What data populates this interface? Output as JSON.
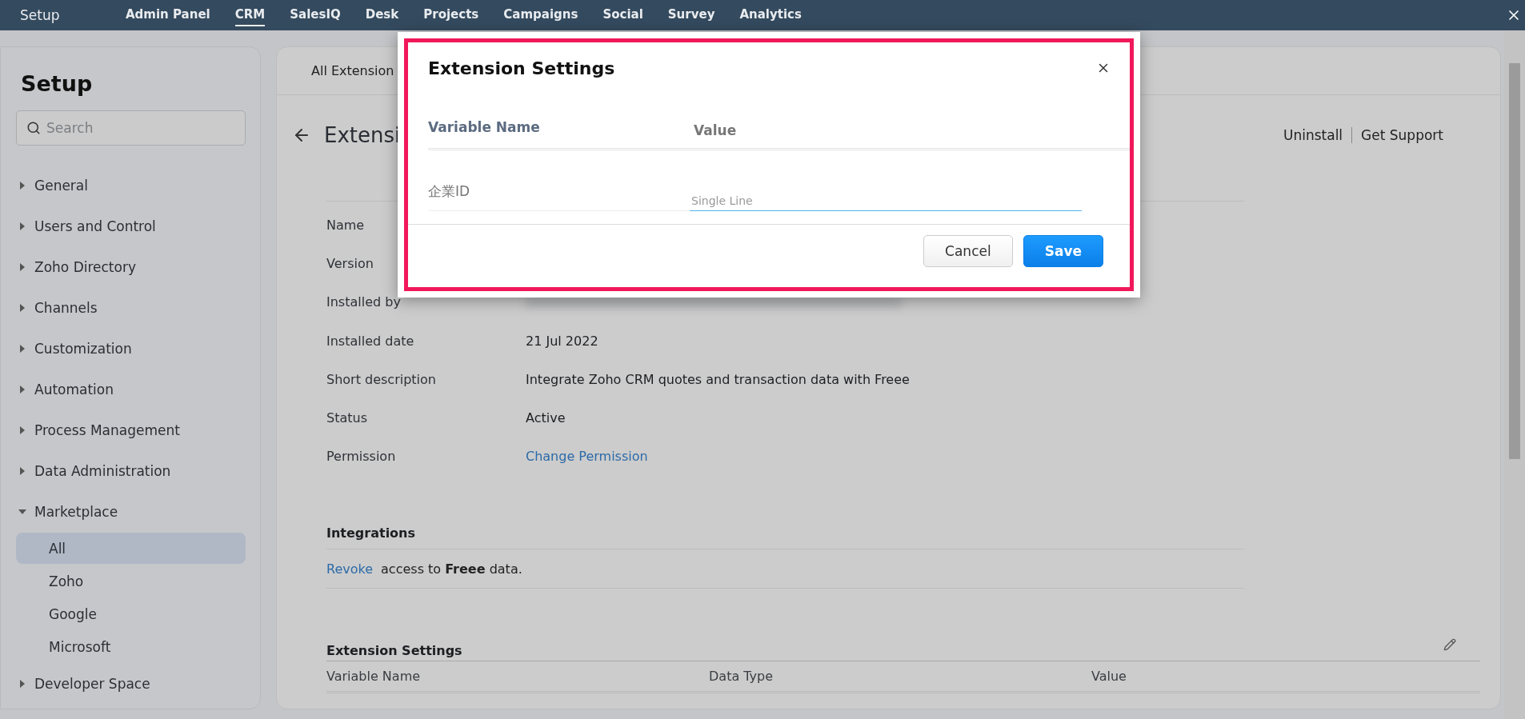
{
  "topbar": {
    "title": "Setup",
    "tabs": [
      {
        "label": "Admin Panel",
        "selected": false
      },
      {
        "label": "CRM",
        "selected": true
      },
      {
        "label": "SalesIQ",
        "selected": false
      },
      {
        "label": "Desk",
        "selected": false
      },
      {
        "label": "Projects",
        "selected": false
      },
      {
        "label": "Campaigns",
        "selected": false
      },
      {
        "label": "Social",
        "selected": false
      },
      {
        "label": "Survey",
        "selected": false
      },
      {
        "label": "Analytics",
        "selected": false
      }
    ]
  },
  "sidebar": {
    "title": "Setup",
    "search": {
      "placeholder": "Search"
    },
    "items": [
      {
        "label": "General",
        "expanded": false
      },
      {
        "label": "Users and Control",
        "expanded": false
      },
      {
        "label": "Zoho Directory",
        "expanded": false
      },
      {
        "label": "Channels",
        "expanded": false
      },
      {
        "label": "Customization",
        "expanded": false
      },
      {
        "label": "Automation",
        "expanded": false
      },
      {
        "label": "Process Management",
        "expanded": false
      },
      {
        "label": "Data Administration",
        "expanded": false
      },
      {
        "label": "Marketplace",
        "expanded": true,
        "children": [
          {
            "label": "All",
            "selected": true
          },
          {
            "label": "Zoho",
            "selected": false
          },
          {
            "label": "Google",
            "selected": false
          },
          {
            "label": "Microsoft",
            "selected": false
          }
        ]
      },
      {
        "label": "Developer Space",
        "expanded": false
      }
    ]
  },
  "main": {
    "tab": "All Extension",
    "heading": "Extensi",
    "actions": [
      "Uninstall",
      "Get Support"
    ],
    "details": [
      {
        "label": "Name",
        "kind": "hidden"
      },
      {
        "label": "Version",
        "kind": "hidden"
      },
      {
        "label": "Installed by",
        "kind": "blurred"
      },
      {
        "label": "Installed date",
        "kind": "text",
        "value": "21 Jul 2022"
      },
      {
        "label": "Short description",
        "kind": "text",
        "value": "Integrate Zoho CRM quotes and transaction data with Freee"
      },
      {
        "label": "Status",
        "kind": "text",
        "value": "Active"
      },
      {
        "label": "Permission",
        "kind": "link",
        "value": "Change Permission"
      }
    ],
    "integrations": {
      "title": "Integrations",
      "link": "Revoke",
      "text": "access to **Freee** data."
    },
    "extension_settings": {
      "title": "Extension Settings",
      "columns": [
        "Variable Name",
        "Data Type",
        "Value"
      ]
    }
  },
  "dialog": {
    "title": "Extension Settings",
    "columns": [
      "Variable Name",
      "Value"
    ],
    "rows": [
      {
        "name": "企業ID",
        "placeholder": "Single Line"
      }
    ],
    "buttons": {
      "cancel": "Cancel",
      "save": "Save"
    }
  }
}
